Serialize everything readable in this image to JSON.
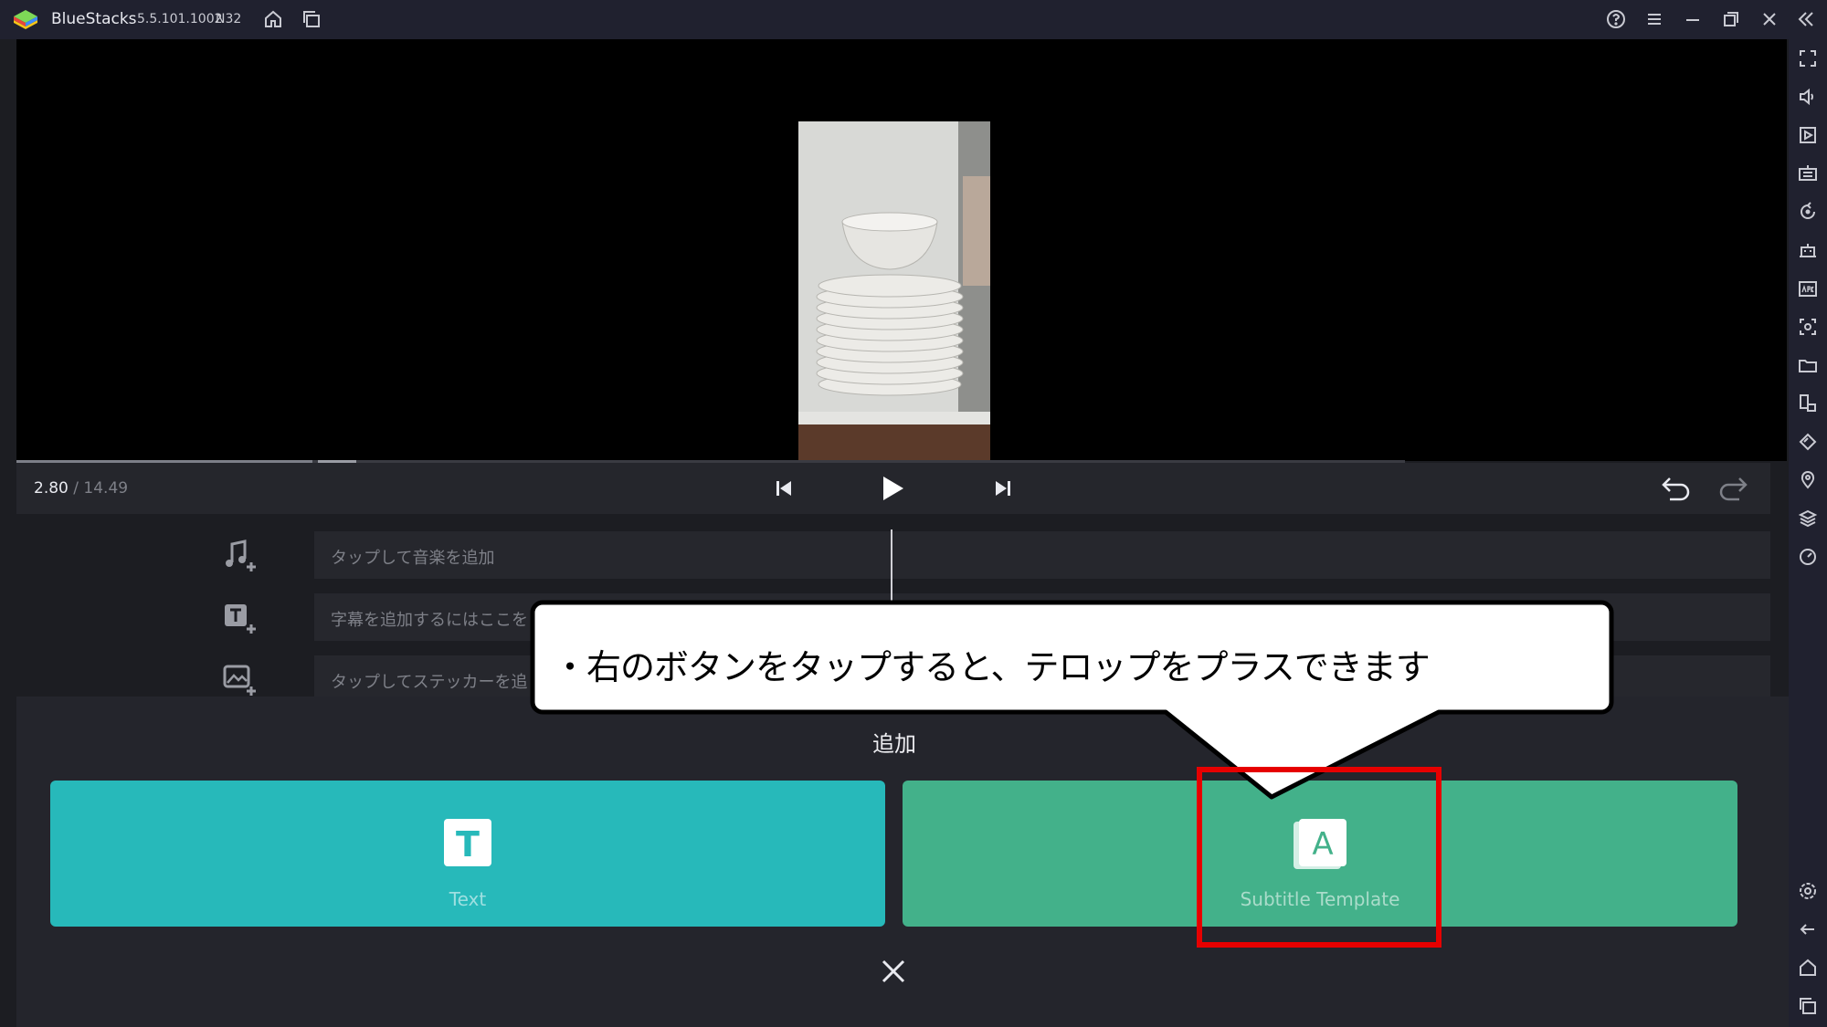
{
  "app": {
    "name": "BlueStacks",
    "version": "5.5.101.1002",
    "build": "N32"
  },
  "player": {
    "current_time": "2.80",
    "separator": " / ",
    "total_time": "14.49"
  },
  "tracks": {
    "music_placeholder": "タップして音楽を追加",
    "subtitle_placeholder": "字幕を追加するにはここを",
    "sticker_placeholder": "タップしてステッカーを追"
  },
  "add_sheet": {
    "title": "追加",
    "text_option": {
      "label": "Text",
      "icon": "T"
    },
    "subtitle_template_option": {
      "label": "Subtitle Template",
      "icon": "A"
    },
    "colors": {
      "text_card": "#27b9ba",
      "subtitle_card": "#43b18a"
    }
  },
  "annotation": {
    "callout_text": "・右のボタンをタップすると、テロップをプラスできます",
    "highlight_color": "#e60000"
  },
  "icons": {
    "titlebar": [
      "home-icon",
      "multi-instance-icon",
      "help-icon",
      "menu-icon",
      "minimize-icon",
      "restore-icon",
      "close-icon",
      "collapse-sidebar-icon"
    ],
    "sidebar": [
      "fullscreen-icon",
      "volume-icon",
      "media-icon",
      "keyboard-icon",
      "rotate-icon",
      "robot-icon",
      "apk-icon",
      "screenshot-icon",
      "folder-icon",
      "multi-window-icon",
      "eco-mode-icon",
      "location-icon",
      "layers-icon",
      "performance-icon",
      "settings-icon",
      "back-icon",
      "android-home-icon",
      "recent-apps-icon"
    ]
  }
}
